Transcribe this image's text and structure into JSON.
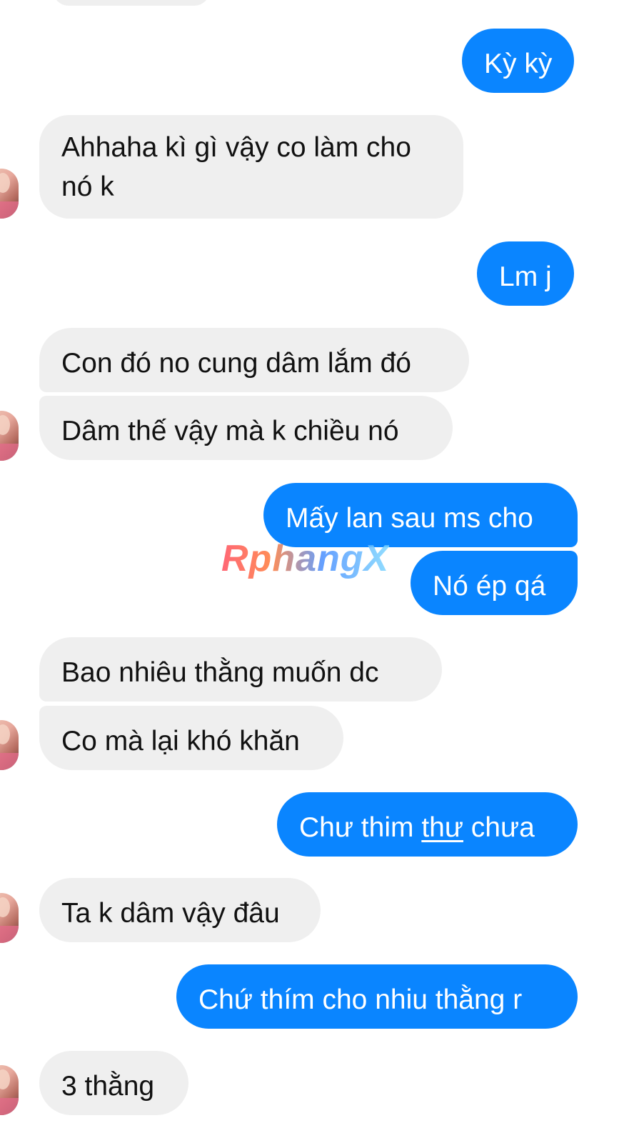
{
  "messages": [
    {
      "side": "out",
      "text": "Kỳ kỳ"
    },
    {
      "side": "in",
      "lines": [
        "Ahhaha kì gì vậy co làm cho",
        "nó k"
      ]
    },
    {
      "side": "out",
      "text": "Lm j"
    },
    {
      "side": "in",
      "text": "Con đó no cung dâm lắm đó"
    },
    {
      "side": "in",
      "text": "Dâm thế vậy mà k chiều nó"
    },
    {
      "side": "out",
      "text": "Mấy lan sau ms cho"
    },
    {
      "side": "out",
      "text": "Nó ép qá"
    },
    {
      "side": "in",
      "text": "Bao nhiêu thằng muốn  dc"
    },
    {
      "side": "in",
      "text": "Co mà lại khó khăn"
    },
    {
      "side": "out",
      "parts": [
        "Chư thim ",
        "thư",
        " chưa"
      ]
    },
    {
      "side": "in",
      "text": "Ta k dâm vậy đâu"
    },
    {
      "side": "out",
      "text": "Chứ thím cho nhiu thằng r"
    },
    {
      "side": "in",
      "text": "3 thằng"
    }
  ],
  "watermark": "RphangX",
  "colors": {
    "outgoing": "#0a85ff",
    "incoming": "#efefef"
  }
}
